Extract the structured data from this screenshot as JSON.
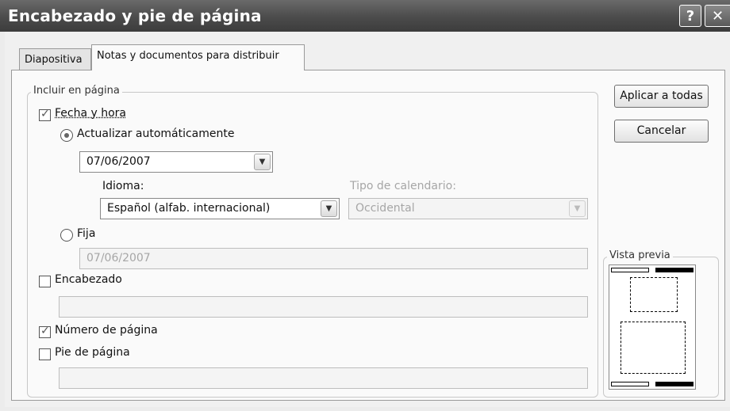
{
  "window": {
    "title": "Encabezado y pie de página",
    "help_button": "?",
    "close_button": "✕"
  },
  "tabs": [
    {
      "label": "Diapositiva",
      "active": false
    },
    {
      "label": "Notas y documentos para distribuir",
      "active": true
    }
  ],
  "include_group": {
    "legend": "Incluir en página",
    "date_time": {
      "label": "Fecha y hora",
      "checked": true
    },
    "auto_update": {
      "label": "Actualizar automáticamente",
      "selected": true,
      "date_value": "07/06/2007"
    },
    "language": {
      "label": "Idioma:",
      "value": "Español (alfab. internacional)"
    },
    "calendar_type": {
      "label": "Tipo de calendario:",
      "value": "Occidental",
      "enabled": false
    },
    "fixed": {
      "label": "Fija",
      "selected": false,
      "value": "07/06/2007",
      "enabled": false
    },
    "header": {
      "label": "Encabezado",
      "checked": false,
      "value": ""
    },
    "page_number": {
      "label": "Número de página",
      "checked": true
    },
    "footer": {
      "label": "Pie de página",
      "checked": false,
      "value": ""
    }
  },
  "buttons": {
    "apply_all": "Aplicar a todas",
    "cancel": "Cancelar"
  },
  "preview": {
    "legend": "Vista previa"
  },
  "icons": {
    "dropdown": "chevron-down-icon",
    "help": "question-icon",
    "close": "close-icon"
  }
}
